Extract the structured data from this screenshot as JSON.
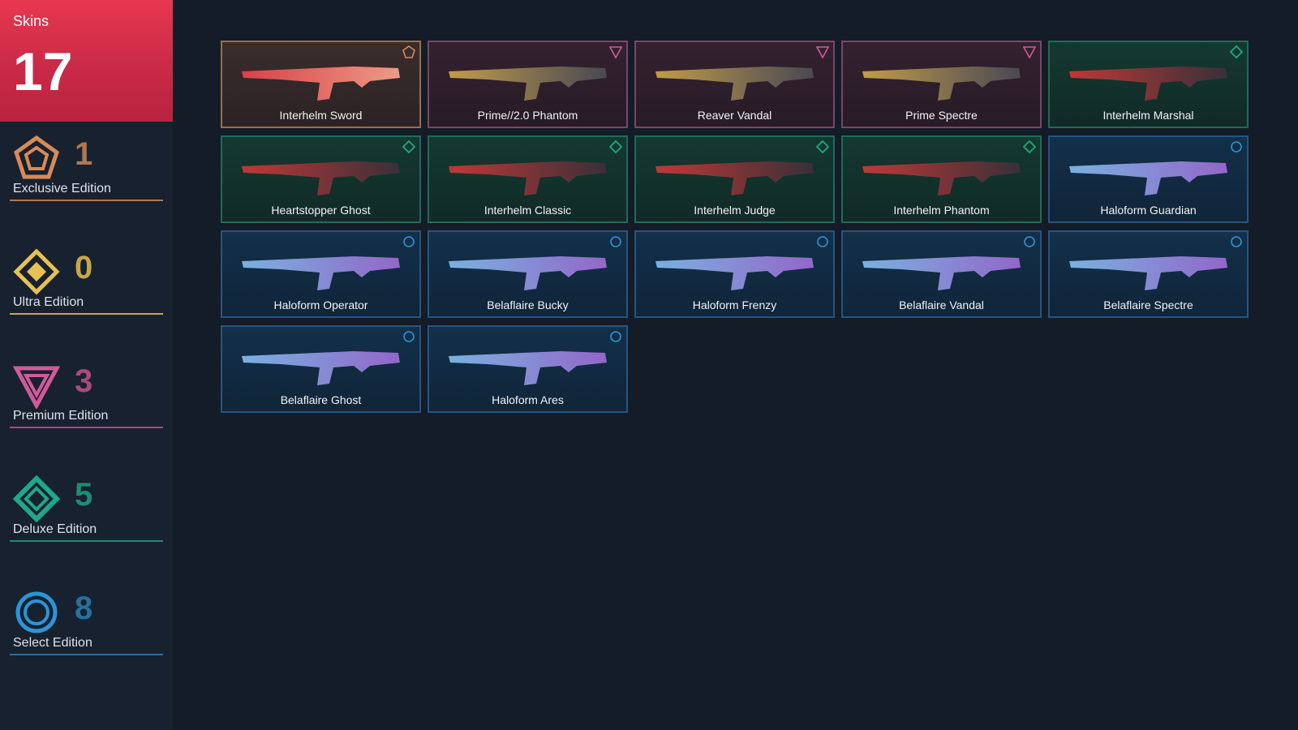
{
  "sidebar": {
    "skins_label": "Skins",
    "skins_count": "17",
    "header_color": "#e23a52",
    "tiers": [
      {
        "label": "Exclusive Edition",
        "count": "1",
        "color": "#d98a57",
        "icon": "exclusive-tier-icon"
      },
      {
        "label": "Ultra Edition",
        "count": "0",
        "color": "#e7c252",
        "icon": "ultra-tier-icon"
      },
      {
        "label": "Premium Edition",
        "count": "3",
        "color": "#d05a9a",
        "icon": "premium-tier-icon"
      },
      {
        "label": "Deluxe Edition",
        "count": "5",
        "color": "#1fa88a",
        "icon": "deluxe-tier-icon"
      },
      {
        "label": "Select Edition",
        "count": "8",
        "color": "#2b95d6",
        "icon": "select-tier-icon"
      }
    ]
  },
  "skins": [
    {
      "name": "Interhelm Sword",
      "tier": "exclusive"
    },
    {
      "name": "Prime//2.0 Phantom",
      "tier": "premium"
    },
    {
      "name": "Reaver Vandal",
      "tier": "premium"
    },
    {
      "name": "Prime Spectre",
      "tier": "premium"
    },
    {
      "name": "Interhelm Marshal",
      "tier": "deluxe"
    },
    {
      "name": "Heartstopper Ghost",
      "tier": "deluxe"
    },
    {
      "name": "Interhelm Classic",
      "tier": "deluxe"
    },
    {
      "name": "Interhelm Judge",
      "tier": "deluxe"
    },
    {
      "name": "Interhelm Phantom",
      "tier": "deluxe"
    },
    {
      "name": "Haloform Guardian",
      "tier": "select"
    },
    {
      "name": "Haloform Operator",
      "tier": "select"
    },
    {
      "name": "Belaflaire Bucky",
      "tier": "select"
    },
    {
      "name": "Haloform Frenzy",
      "tier": "select"
    },
    {
      "name": "Belaflaire Vandal",
      "tier": "select"
    },
    {
      "name": "Belaflaire Spectre",
      "tier": "select"
    },
    {
      "name": "Belaflaire Ghost",
      "tier": "select"
    },
    {
      "name": "Haloform Ares",
      "tier": "select"
    }
  ]
}
